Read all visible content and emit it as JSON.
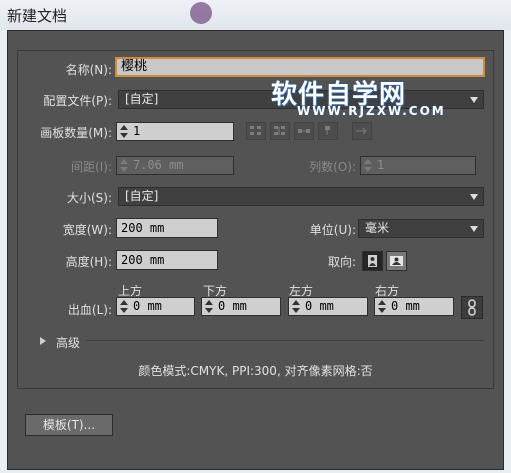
{
  "window": {
    "title": "新建文档"
  },
  "name": {
    "label": "名称(N):",
    "value": "樱桃"
  },
  "profile": {
    "label": "配置文件(P):",
    "value": "[自定]"
  },
  "artboards": {
    "label": "画板数量(M):",
    "value": "1"
  },
  "spacing": {
    "label": "间距(I):",
    "value": "7.06 mm"
  },
  "columns": {
    "label": "列数(O):",
    "value": "1"
  },
  "size": {
    "label": "大小(S):",
    "value": "[自定]"
  },
  "width": {
    "label": "宽度(W):",
    "value": "200 mm"
  },
  "units": {
    "label": "单位(U):",
    "value": "毫米"
  },
  "height": {
    "label": "高度(H):",
    "value": "200 mm"
  },
  "orientation": {
    "label": "取向:"
  },
  "bleed": {
    "label": "出血(L):",
    "top": {
      "label": "上方",
      "value": "0 mm"
    },
    "bottom": {
      "label": "下方",
      "value": "0 mm"
    },
    "left": {
      "label": "左方",
      "value": "0 mm"
    },
    "right": {
      "label": "右方",
      "value": "0 mm"
    }
  },
  "advanced": {
    "label": "高级"
  },
  "info": {
    "text": "颜色模式:CMYK, PPI:300, 对齐像素网格:否"
  },
  "templates_button": {
    "label": "模板(T)..."
  },
  "watermark": {
    "brand": "软件自学网",
    "url": "WWW.RJZXW.COM"
  },
  "colors": {
    "dialog_bg": "#535353",
    "accent_focus": "#d08a3b",
    "watermark_blue": "#2a5f9c"
  },
  "icons": [
    "grid-by-row-icon",
    "grid-by-column-icon",
    "arrange-by-row-icon",
    "arrange-by-column-icon",
    "right-to-left-icon",
    "portrait-icon",
    "landscape-icon",
    "link-bleed-icon",
    "advanced-expand-icon",
    "dropdown-arrow-icon"
  ]
}
